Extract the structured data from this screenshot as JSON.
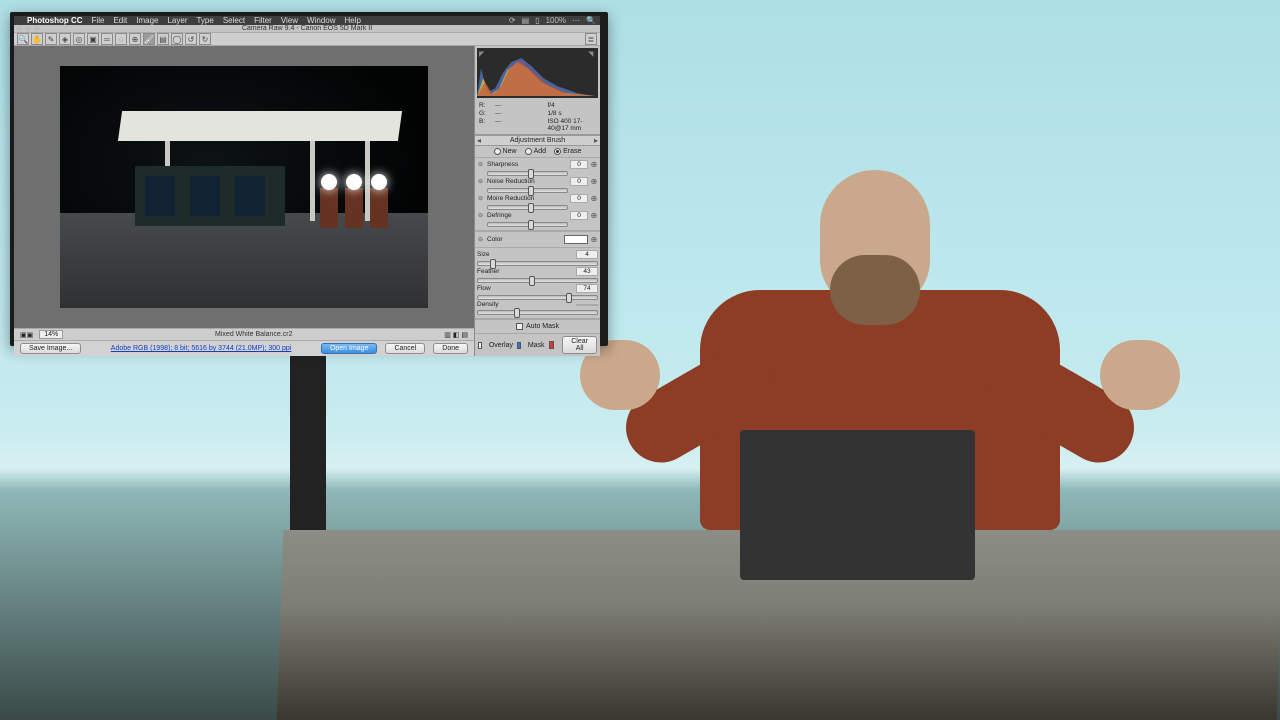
{
  "menubar": {
    "app": "Photoshop CC",
    "items": [
      "File",
      "Edit",
      "Image",
      "Layer",
      "Type",
      "Select",
      "Filter",
      "View",
      "Window",
      "Help"
    ],
    "right_zoom": "100%"
  },
  "traffic_dots": 3,
  "window_title": "Camera Raw 9.4  -  Canon EOS 5D Mark II",
  "toolbar_icons": [
    "zoom",
    "hand",
    "wb-eyedropper",
    "color-sampler",
    "target",
    "crop",
    "straighten",
    "spot",
    "redeye",
    "adjust-brush",
    "grad-filter",
    "radial-filter",
    "rotate-ccw",
    "rotate-cw"
  ],
  "toolbar_selected_index": 9,
  "zoom_percent": "14%",
  "filename": "Mixed White Balance.cr2",
  "metadata_link": "Adobe RGB (1998); 8 bit; 5616 by 3744 (21.0MP); 300 ppi",
  "buttons": {
    "save_image": "Save Image...",
    "open_image": "Open Image",
    "cancel": "Cancel",
    "done": "Done"
  },
  "info_readout": {
    "r_label": "R:",
    "g_label": "G:",
    "b_label": "B:",
    "r": "---",
    "g": "---",
    "b": "---",
    "fstop": "f/4",
    "shutter": "1/8 s",
    "iso": "ISO 400",
    "lens": "17-40@17 mm"
  },
  "panel_title": "Adjustment Brush",
  "mode": {
    "options": [
      "New",
      "Add",
      "Erase"
    ],
    "selected": 2
  },
  "adjust_sliders": [
    {
      "name": "Sharpness",
      "value": "0",
      "pos": 50
    },
    {
      "name": "Noise Reduction",
      "value": "0",
      "pos": 50
    },
    {
      "name": "Moire Reduction",
      "value": "0",
      "pos": 50
    },
    {
      "name": "Defringe",
      "value": "0",
      "pos": 50
    }
  ],
  "color_label": "Color",
  "brush_sliders": [
    {
      "name": "Size",
      "value": "4",
      "pos": 10
    },
    {
      "name": "Feather",
      "value": "43",
      "pos": 43
    },
    {
      "name": "Flow",
      "value": "74",
      "pos": 74
    },
    {
      "name": "Density",
      "value": "",
      "pos": 30,
      "disabled": true
    }
  ],
  "auto_mask_label": "Auto Mask",
  "auto_mask_checked": false,
  "footer": {
    "overlay_label": "Overlay",
    "overlay_checked": false,
    "mask_label": "Mask",
    "mask_checked": true,
    "clear_all": "Clear All"
  }
}
